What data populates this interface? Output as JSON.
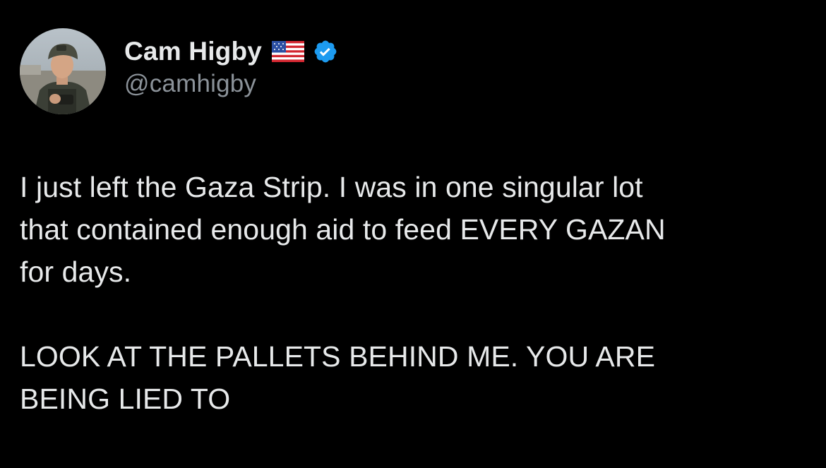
{
  "author": {
    "display_name": "Cam Higby",
    "handle": "@camhigby",
    "flag_icon": "us-flag-icon",
    "verified_icon": "verified-badge-icon",
    "verified_color": "#1d9bf0"
  },
  "tweet": {
    "paragraphs": [
      "I just left the Gaza Strip. I was in one singular lot\nthat contained enough aid to feed EVERY GAZAN\nfor days.",
      "LOOK AT THE PALLETS BEHIND ME. YOU ARE\nBEING LIED TO"
    ]
  },
  "theme": {
    "background": "#000000",
    "text": "#e7e9ea",
    "secondary_text": "#8b9299"
  }
}
